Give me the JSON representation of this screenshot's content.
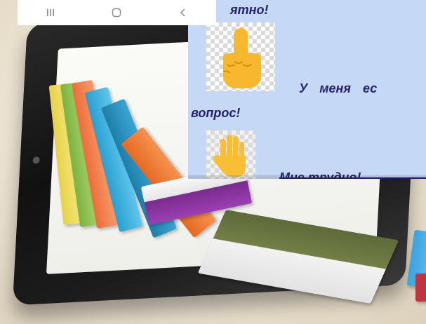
{
  "navigation_bar": {
    "buttons": [
      {
        "name": "recents",
        "icon": "recents-icon"
      },
      {
        "name": "home",
        "icon": "home-icon"
      },
      {
        "name": "back",
        "icon": "back-icon"
      }
    ],
    "background": "#ffffff",
    "icon_color": "#8a8a8a"
  },
  "card": {
    "background": "#c5d8f6",
    "text_color": "#28226b",
    "lines": {
      "understand": "ятно!",
      "question_part1": "У меня ес",
      "question_part2": "вопрос!",
      "hard": "Мне трудно!"
    },
    "icons": [
      {
        "name": "pointing-up-finger-icon",
        "meaning": "question"
      },
      {
        "name": "raised-hand-icon",
        "meaning": "difficulty"
      }
    ]
  },
  "background_photo": {
    "subject": "tablet with books coming out of the screen",
    "icons": [
      "tablet-image",
      "books-image"
    ]
  }
}
